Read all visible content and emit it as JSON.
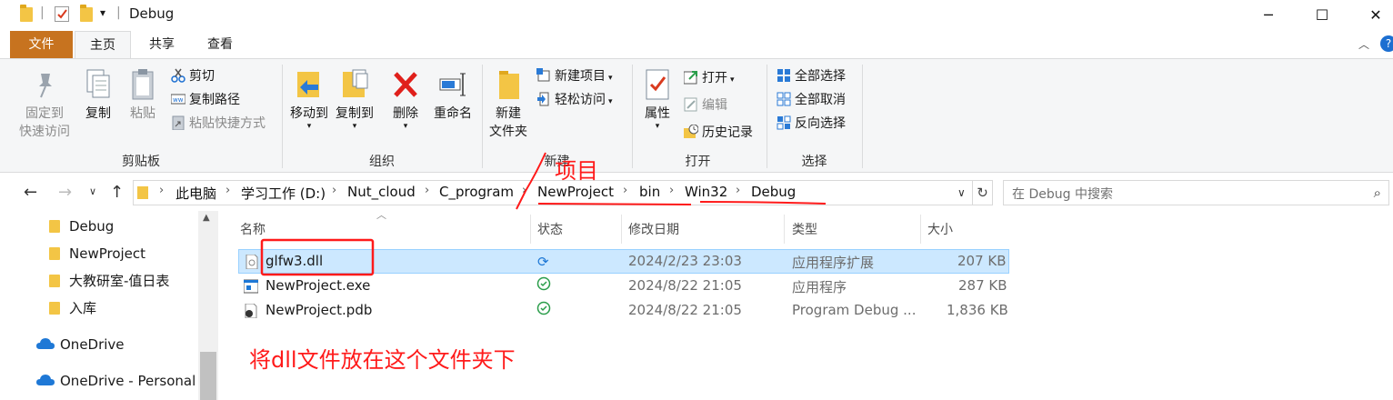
{
  "window": {
    "title": "Debug",
    "qat_dropdown": "▾",
    "minimize": "─",
    "maximize": "☐",
    "close": "✕"
  },
  "ribbon_tabs": [
    "文件",
    "主页",
    "共享",
    "查看"
  ],
  "ribbon": {
    "clipboard": {
      "label": "剪贴板",
      "pin": "固定到\n快速访问",
      "pin_line1": "固定到",
      "pin_line2": "快速访问",
      "copy": "复制",
      "paste": "粘贴",
      "cut": "剪切",
      "copy_path": "复制路径",
      "paste_shortcut": "粘贴快捷方式"
    },
    "organize": {
      "label": "组织",
      "move_to": "移动到",
      "copy_to": "复制到",
      "delete": "删除",
      "rename": "重命名"
    },
    "new": {
      "label": "新建",
      "new_folder_line1": "新建",
      "new_folder_line2": "文件夹",
      "new_item": "新建项目",
      "easy_access": "轻松访问"
    },
    "open": {
      "label": "打开",
      "properties": "属性",
      "open": "打开",
      "edit": "编辑",
      "history": "历史记录"
    },
    "select": {
      "label": "选择",
      "select_all": "全部选择",
      "select_none": "全部取消",
      "invert": "反向选择"
    }
  },
  "address": {
    "crumbs": [
      "此电脑",
      "学习工作 (D:)",
      "Nut_cloud",
      "C_program",
      "NewProject",
      "bin",
      "Win32",
      "Debug"
    ],
    "search_placeholder": "在 Debug 中搜索"
  },
  "nav_pane": {
    "folders": [
      "Debug",
      "NewProject",
      "大教研室-值日表",
      "入库"
    ],
    "clouds": [
      "OneDrive",
      "OneDrive - Personal"
    ]
  },
  "columns": [
    "名称",
    "状态",
    "修改日期",
    "类型",
    "大小"
  ],
  "files": [
    {
      "name": "glfw3.dll",
      "status": "sync",
      "date": "2024/2/23 23:03",
      "type": "应用程序扩展",
      "size": "207 KB",
      "selected": true
    },
    {
      "name": "NewProject.exe",
      "status": "ok",
      "date": "2024/8/22 21:05",
      "type": "应用程序",
      "size": "287 KB",
      "selected": false
    },
    {
      "name": "NewProject.pdb",
      "status": "ok",
      "date": "2024/8/22 21:05",
      "type": "Program Debug ...",
      "size": "1,836 KB",
      "selected": false
    }
  ],
  "annotations": {
    "project_label": "项目",
    "instruction": "将dll文件放在这个文件夹下",
    "color": "#ff1a1a"
  },
  "colors": {
    "file_tab": "#c7731f",
    "selection": "#cce8ff",
    "folder": "#f3c545"
  }
}
